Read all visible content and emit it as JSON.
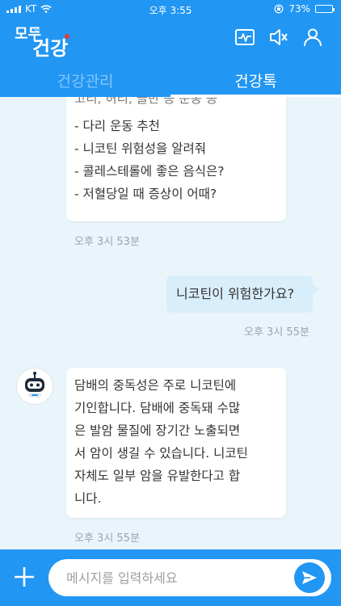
{
  "status_bar": {
    "carrier": "KT",
    "time": "오후 3:55",
    "battery": "73%",
    "battery_level": 0.73
  },
  "brand": {
    "line1": "모두",
    "small": "의",
    "line2": "건강"
  },
  "header_icons": [
    "heart-monitor-icon",
    "speaker-muted-icon",
    "person-icon"
  ],
  "tabs": [
    {
      "label": "건강관리",
      "active": false
    },
    {
      "label": "건강톡",
      "active": true
    }
  ],
  "chat": {
    "cut_line": "고리, 허리, 골반 등 운동 등",
    "suggestions": [
      "- 다리 운동 추천",
      "- 니코틴 위험성을 알려줘",
      "- 콜레스테롤에 좋은 음식은?",
      "- 저혈당일 때 증상이 어때?"
    ],
    "time1": "오후 3시 53분",
    "user_message": "니코틴이 위험한가요?",
    "time2": "오후 3시 55분",
    "bot_lines": [
      "담배의 중독성은 주로 니코틴에",
      "기인합니다. 담배에 중독돼 수많",
      "은 발암 물질에 장기간 노출되면",
      "서 암이 생길 수 있습니다. 니코틴",
      "자체도 일부 암을 유발한다고 합",
      "니다."
    ],
    "time3": "오후 3시 55분"
  },
  "input": {
    "placeholder": "메시지를 입력하세요",
    "value": ""
  },
  "colors": {
    "primary": "#2196f3",
    "background": "#e9f5fb",
    "user_bubble": "#d9eefb",
    "logo_dot": "#e53935"
  }
}
